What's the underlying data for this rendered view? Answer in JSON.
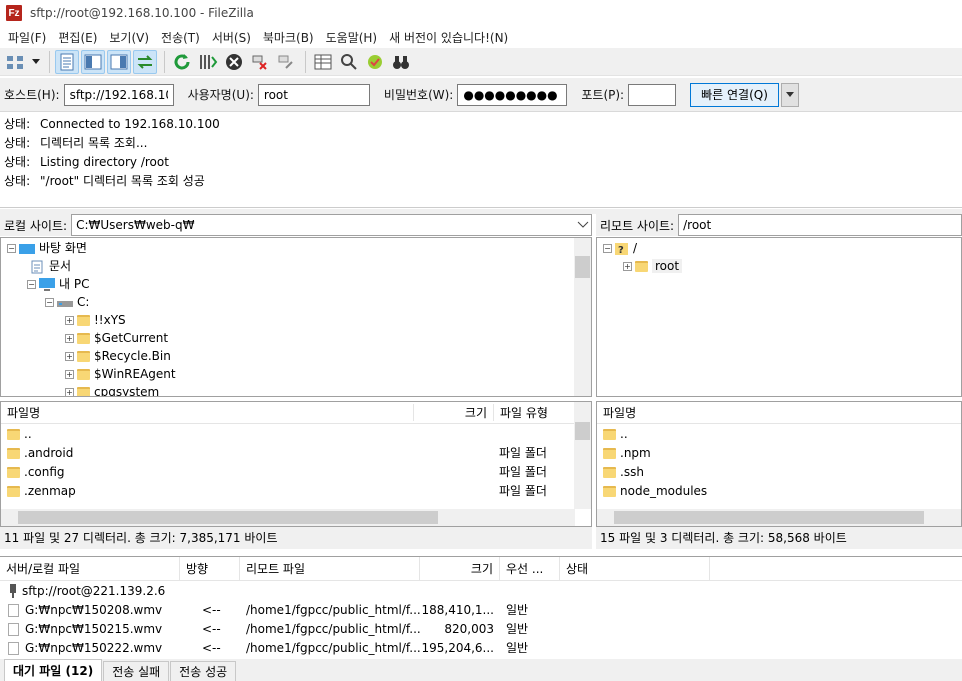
{
  "window": {
    "title": "sftp://root@192.168.10.100 - FileZilla",
    "app_icon": "Fz"
  },
  "menu": [
    "파일(F)",
    "편집(E)",
    "보기(V)",
    "전송(T)",
    "서버(S)",
    "북마크(B)",
    "도움말(H)",
    "새 버전이 있습니다!(N)"
  ],
  "quickconnect": {
    "host_label": "호스트(H):",
    "host_value": "sftp://192.168.10.1",
    "user_label": "사용자명(U):",
    "user_value": "root",
    "pass_label": "비밀번호(W):",
    "pass_value": "●●●●●●●●●",
    "port_label": "포트(P):",
    "port_value": "",
    "connect_label": "빠른 연결(Q)"
  },
  "log": [
    {
      "k": "상태:",
      "v": "Connected to 192.168.10.100"
    },
    {
      "k": "상태:",
      "v": "디렉터리 목록 조회..."
    },
    {
      "k": "상태:",
      "v": "Listing directory /root"
    },
    {
      "k": "상태:",
      "v": "\"/root\" 디렉터리 목록 조회 성공"
    }
  ],
  "local": {
    "site_label": "로컬 사이트:",
    "path": "C:₩Users₩web-q₩",
    "tree": [
      {
        "label": "바탕 화면",
        "icon": "desktop"
      },
      {
        "label": "문서",
        "icon": "document"
      },
      {
        "label": "내 PC",
        "icon": "pc"
      },
      {
        "label": "C:",
        "icon": "drive"
      },
      {
        "label": "!!xYS",
        "icon": "folder"
      },
      {
        "label": "$GetCurrent",
        "icon": "folder"
      },
      {
        "label": "$Recycle.Bin",
        "icon": "folder"
      },
      {
        "label": "$WinREAgent",
        "icon": "folder"
      },
      {
        "label": "cpgsystem",
        "icon": "folder"
      }
    ],
    "cols": {
      "name": "파일명",
      "size": "크기",
      "type": "파일 유형"
    },
    "files": [
      {
        "name": "..",
        "type": ""
      },
      {
        "name": ".android",
        "type": "파일 폴더"
      },
      {
        "name": ".config",
        "type": "파일 폴더"
      },
      {
        "name": ".zenmap",
        "type": "파일 폴더"
      }
    ],
    "status": "11 파일 및 27 디렉터리. 총 크기: 7,385,171 바이트"
  },
  "remote": {
    "site_label": "리모트 사이트:",
    "path": "/root",
    "tree": [
      {
        "label": "/"
      },
      {
        "label": "root"
      }
    ],
    "cols": {
      "name": "파일명"
    },
    "files": [
      {
        "name": ".."
      },
      {
        "name": ".npm"
      },
      {
        "name": ".ssh"
      },
      {
        "name": "node_modules"
      }
    ],
    "status": "15 파일 및 3 디렉터리. 총 크기: 58,568 바이트"
  },
  "queue": {
    "cols": {
      "server": "서버/로컬 파일",
      "dir": "방향",
      "remote": "리모트 파일",
      "size": "크기",
      "prio": "우선 ...",
      "status": "상태"
    },
    "server": "sftp://root@221.139.2.6",
    "rows": [
      {
        "local": "G:₩npc₩150208.wmv",
        "dir": "<--",
        "remote": "/home1/fgpcc/public_html/f...",
        "size": "188,410,1...",
        "prio": "일반"
      },
      {
        "local": "G:₩npc₩150215.wmv",
        "dir": "<--",
        "remote": "/home1/fgpcc/public_html/f...",
        "size": "820,003",
        "prio": "일반"
      },
      {
        "local": "G:₩npc₩150222.wmv",
        "dir": "<--",
        "remote": "/home1/fgpcc/public_html/f...",
        "size": "195,204,6...",
        "prio": "일반"
      }
    ]
  },
  "tabs": [
    "대기 파일 (12)",
    "전송 실패",
    "전송 성공"
  ]
}
